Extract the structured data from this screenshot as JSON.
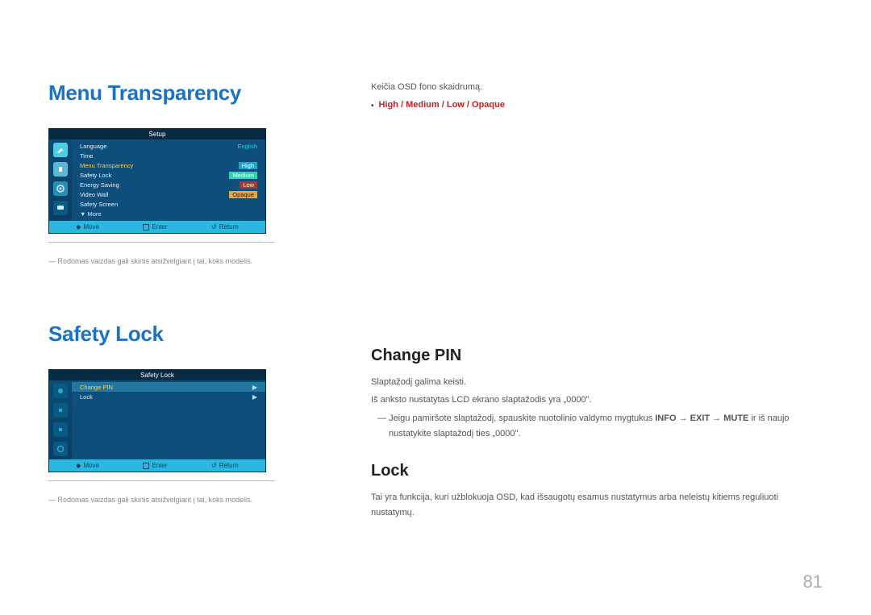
{
  "page_number": "81",
  "sections": {
    "menu_transparency": {
      "heading": "Menu Transparency",
      "description": "Keičia OSD fono skaidrumą.",
      "options_line": "High / Medium / Low / Opaque",
      "disclaimer": "Rodomas vaizdas gali skirtis atsižvelgiant į tai, koks modelis.",
      "osd": {
        "title": "Setup",
        "rows": {
          "language_label": "Language",
          "language_value": "English",
          "time_label": "Time",
          "mt_label": "Menu Transparency",
          "mt_high": "High",
          "sl_label": "Safety Lock",
          "sl_val": "Medium",
          "es_label": "Energy Saving",
          "es_val": "Low",
          "vw_label": "Video Wall",
          "vw_val": "Opaque",
          "ss_label": "Safety Screen",
          "more": "▼ More"
        },
        "footer": {
          "move": "Move",
          "enter": "Enter",
          "return": "Return"
        }
      }
    },
    "safety_lock": {
      "heading": "Safety Lock",
      "disclaimer": "Rodomas vaizdas gali skirtis atsižvelgiant į tai, koks modelis.",
      "osd": {
        "title": "Safety Lock",
        "row_change_pin": "Change PIN",
        "row_lock": "Lock",
        "footer": {
          "move": "Move",
          "enter": "Enter",
          "return": "Return"
        }
      },
      "change_pin": {
        "heading": "Change PIN",
        "line1": "Slaptažodį galima keisti.",
        "line2": "Iš anksto nustatytas LCD ekrano slaptažodis yra „0000\".",
        "line3_pre": "Jeigu pamiršote slaptažodį, spauskite nuotolinio valdymo mygtukus ",
        "line3_info": "INFO",
        "line3_arrow1": " → ",
        "line3_exit": "EXIT",
        "line3_arrow2": " → ",
        "line3_mute": "MUTE",
        "line3_post": " ir iš naujo nustatykite slaptažodį ties „0000\"."
      },
      "lock": {
        "heading": "Lock",
        "line1": "Tai yra funkcija, kuri užblokuoja OSD, kad išsaugotų esamus nustatymus arba neleistų kitiems reguliuoti nustatymų."
      }
    }
  }
}
